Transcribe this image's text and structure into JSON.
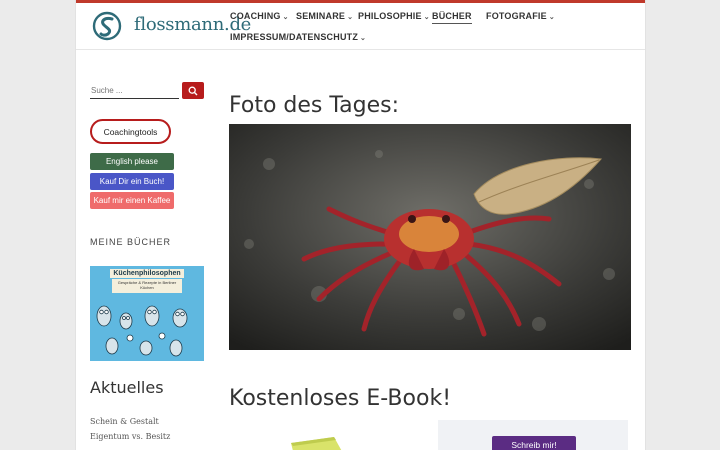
{
  "header": {
    "logo_text": "flossmann.de",
    "nav": [
      {
        "label": "COACHING"
      },
      {
        "label": "SEMINARE"
      },
      {
        "label": "PHILOSOPHIE"
      },
      {
        "label": "BÜCHER",
        "active": true
      },
      {
        "label": "FOTOGRAFIE"
      },
      {
        "label": "IMPRESSUM/DATENSCHUTZ"
      }
    ]
  },
  "sidebar": {
    "search_placeholder": "Suche ...",
    "coaching_button": "Coachingtools",
    "english_button": "English please",
    "book_button": "Kauf Dir ein Buch!",
    "coffee_button": "Kauf mir einen Kaffee",
    "books_title": "MEINE BÜCHER",
    "book_cover_title": "Küchenphilosophen",
    "book_cover_subtitle": "Gespräche & Rezepte in Berliner Küchen",
    "aktuelles_title": "Aktuelles",
    "posts": [
      "Schein & Gestalt",
      "Eigentum vs. Besitz"
    ]
  },
  "main": {
    "photo_title": "Foto des Tages:",
    "ebook_title": "Kostenloses E-Book!",
    "ebook_button": "Schreib mir!"
  },
  "colors": {
    "accent": "#b71c1c",
    "english": "#3e6b48",
    "buy_book": "#4a56c7",
    "coffee": "#ef6b6b",
    "ebook_button": "#5b2c83"
  }
}
